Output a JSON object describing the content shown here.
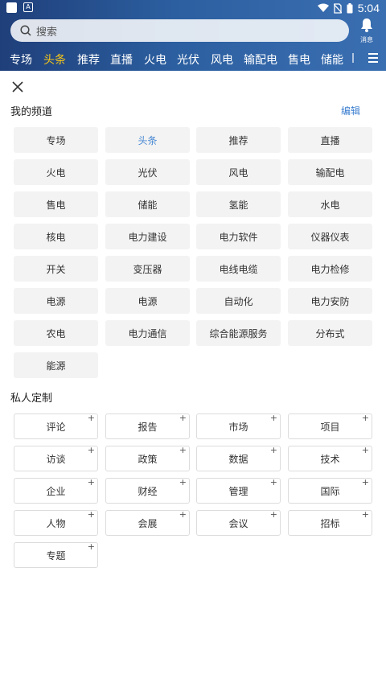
{
  "status_bar": {
    "time": "5:04",
    "app_icon_letter": "A"
  },
  "search": {
    "placeholder": "搜索"
  },
  "message": {
    "label": "消息"
  },
  "tabs": [
    "专场",
    "头条",
    "推荐",
    "直播",
    "火电",
    "光伏",
    "风电",
    "输配电",
    "售电",
    "储能"
  ],
  "active_tab": "头条",
  "my_channels": {
    "title": "我的频道",
    "edit_label": "编辑",
    "items": [
      "专场",
      "头条",
      "推荐",
      "直播",
      "火电",
      "光伏",
      "风电",
      "输配电",
      "售电",
      "储能",
      "氢能",
      "水电",
      "核电",
      "电力建设",
      "电力软件",
      "仪器仪表",
      "开关",
      "变压器",
      "电线电缆",
      "电力检修",
      "电源",
      "电源",
      "自动化",
      "电力安防",
      "农电",
      "电力通信",
      "综合能源服务",
      "分布式",
      "能源"
    ],
    "active_index": 1
  },
  "custom": {
    "title": "私人定制",
    "add_symbol": "+",
    "items": [
      "评论",
      "报告",
      "市场",
      "项目",
      "访谈",
      "政策",
      "数据",
      "技术",
      "企业",
      "财经",
      "管理",
      "国际",
      "人物",
      "会展",
      "会议",
      "招标",
      "专题"
    ]
  },
  "colors": {
    "accent": "#3a7ecf",
    "active_tab": "#f5c518",
    "header_start": "#1f3f7a",
    "header_end": "#3a6fb2"
  }
}
